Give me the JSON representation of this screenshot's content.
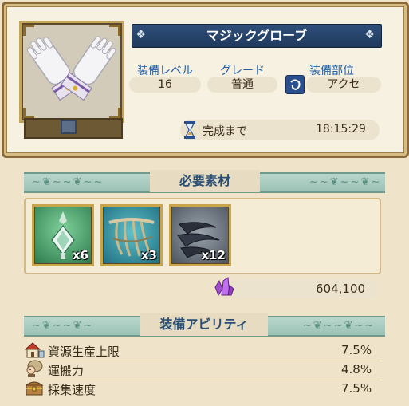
{
  "item": {
    "name": "マジックグローブ",
    "stats": {
      "level_label": "装備レベル",
      "level_value": "16",
      "grade_label": "グレード",
      "grade_value": "普通",
      "slot_label": "装備部位",
      "slot_value": "アクセ"
    },
    "timer_label": "完成まで",
    "timer_value": "18:15:29"
  },
  "materials_section": {
    "title": "必要素材",
    "items": [
      {
        "icon": "crystal-lantern-icon",
        "count": "x6"
      },
      {
        "icon": "ribcage-bones-icon",
        "count": "x3"
      },
      {
        "icon": "claws-icon",
        "count": "x12"
      }
    ],
    "cost_value": "604,100",
    "cost_icon": "purple-crystal-icon"
  },
  "ability_section": {
    "title": "装備アビリティ",
    "rows": [
      {
        "icon": "building-icon",
        "label": "資源生産上限",
        "value": "7.5%"
      },
      {
        "icon": "porter-icon",
        "label": "運搬力",
        "value": "4.8%"
      },
      {
        "icon": "treasure-chest-icon",
        "label": "採集速度",
        "value": "7.5%"
      }
    ]
  },
  "colors": {
    "title_bar": "#2e4e7a",
    "label_blue": "#1e5fa8",
    "frame_gold": "#c8a54a"
  }
}
